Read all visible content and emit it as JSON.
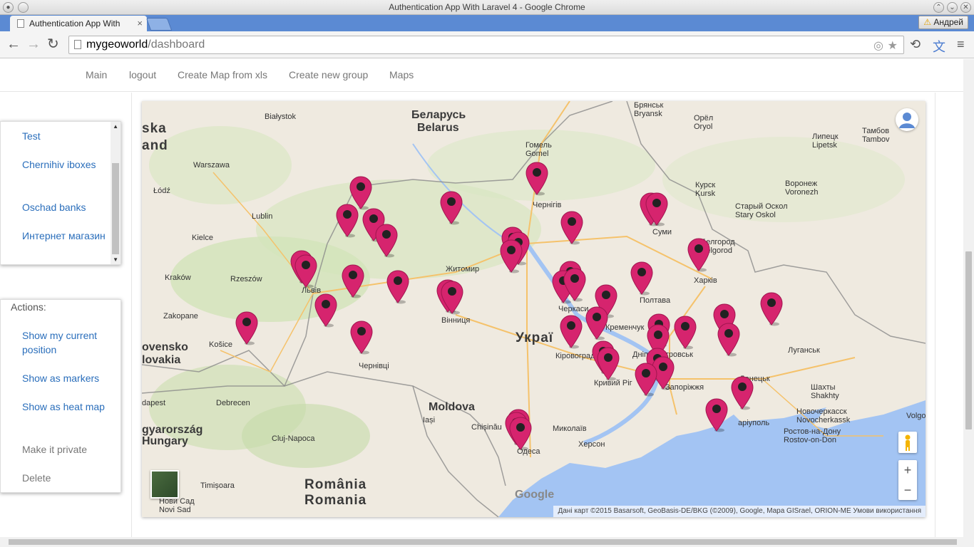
{
  "window": {
    "title": "Authentication App With Laravel 4 - Google Chrome"
  },
  "tabs": [
    {
      "label": "Authentication App With"
    }
  ],
  "user_badge": "Андрей",
  "address": {
    "host": "mygeoworld",
    "path": "/dashboard"
  },
  "nav": [
    "Main",
    "logout",
    "Create Map from xls",
    "Create new group",
    "Maps"
  ],
  "groups": [
    "Test",
    "Chernihiv iboxes",
    "Oschad banks",
    "Интернет магазин"
  ],
  "actions": {
    "header": "Actions:",
    "items": [
      "Show my current position",
      "Show as markers",
      "Show as heat map",
      "Make it private",
      "Delete"
    ]
  },
  "map": {
    "labels": {
      "belarus_uk": "Беларусь",
      "belarus_en": "Belarus",
      "ukraine": "Украї",
      "moldova": "Moldova",
      "romania_ro": "România",
      "romania_en": "Romania",
      "hungary_hu": "gyarország",
      "hungary_en": "Hungary",
      "slovakia_sk": "ovensko",
      "slovakia_en": "lovakia",
      "poland_a": "ska",
      "poland_b": "and",
      "bialystok": "Białystok",
      "warszawa": "Warszawa",
      "lodz": "Łódź",
      "lublin": "Lublin",
      "kielce": "Kielce",
      "krakow": "Kraków",
      "rzeszow": "Rzeszów",
      "zakopane": "Zakopane",
      "kosice": "Košice",
      "debrecen": "Debrecen",
      "budapest": "dapest",
      "cluj": "Cluj-Napoca",
      "timisoara": "Timișoara",
      "novisad": "Нови Сад\nNovi Sad",
      "iasi": "Iași",
      "chisinau": "Chișinău",
      "gomel": "Гомель\nGomel",
      "bryansk": "Брянськ\nBryansk",
      "orel": "Орёл\nOryol",
      "lipetsk": "Липецк\nLipetsk",
      "tambov": "Тамбов\nTambov",
      "kursk": "Курск\nKursk",
      "voronezh": "Воронеж\nVoronezh",
      "staryoskol": "Старый Оскол\nStary Oskol",
      "belgorod": "Белгород\nBelgorod",
      "kharkiv": "Харків",
      "lugansk": "Луганськ",
      "donetsk": "Донецьк",
      "shakhty": "Шахты\nShakhty",
      "novocherkassk": "Новочеркасск\nNovocherkassk",
      "rostov": "Ростов-на-Дону\nRostov-on-Don",
      "volgo": "Volgo",
      "mariupol": "аріуполь",
      "chernihiv": "Чернігів",
      "zhytomyr": "Житомир",
      "lviv": "Львів",
      "vinnytsia": "Вінниця",
      "chernivtsi": "Чернівці",
      "cherkasy": "Черкаси",
      "kropyvnytskyi": "Кіровоград",
      "kryvyirih": "Кривий Ріг",
      "dnipro": "Дніпропетровськ",
      "zaporizhzhia": "Запоріжжя",
      "poltava": "Полтава",
      "sumy": "Суми",
      "kremenchuk": "Кременчук",
      "mykolaiv": "Миколаїв",
      "kherson": "Херсон",
      "odesa": "Одеса"
    },
    "google": "Google",
    "attribution": "Дані карт ©2015 Basarsoft, GeoBasis-DE/BKG (©2009), Google, Mapa GISrael, ORION-ME    Умови використання",
    "marker_color": "#d6246e"
  }
}
